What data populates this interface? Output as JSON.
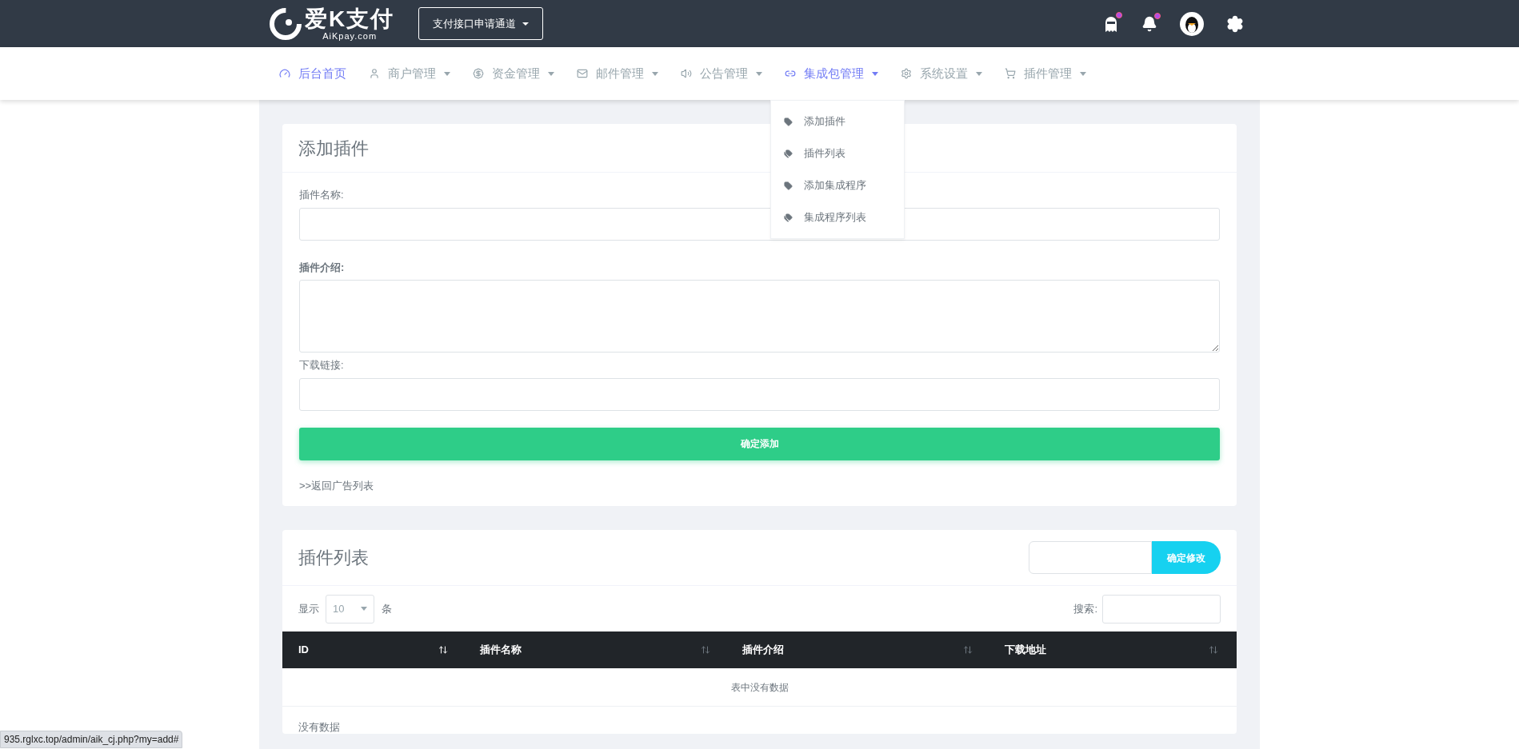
{
  "header": {
    "logo_text": "爱K支付",
    "logo_subtext": "AiKpay.com",
    "channel_button": "支付接口申请通道"
  },
  "nav": [
    {
      "label": "后台首页",
      "highlighted": true,
      "has_caret": false
    },
    {
      "label": "商户管理",
      "highlighted": false,
      "has_caret": true
    },
    {
      "label": "资金管理",
      "highlighted": false,
      "has_caret": true
    },
    {
      "label": "邮件管理",
      "highlighted": false,
      "has_caret": true
    },
    {
      "label": "公告管理",
      "highlighted": false,
      "has_caret": true
    },
    {
      "label": "集成包管理",
      "highlighted": true,
      "has_caret": true
    },
    {
      "label": "系统设置",
      "highlighted": false,
      "has_caret": true
    },
    {
      "label": "插件管理",
      "highlighted": false,
      "has_caret": true
    }
  ],
  "dropdown": [
    {
      "label": "添加插件",
      "kind": "add"
    },
    {
      "label": "插件列表",
      "kind": "list"
    },
    {
      "label": "添加集成程序",
      "kind": "add"
    },
    {
      "label": "集成程序列表",
      "kind": "list"
    }
  ],
  "add_form": {
    "title": "添加插件",
    "fields": [
      {
        "label": "插件名称:",
        "kind": "input",
        "bold": false
      },
      {
        "label": "插件介绍:",
        "kind": "textarea",
        "bold": true
      },
      {
        "label": "下载链接:",
        "kind": "input",
        "bold": false
      }
    ],
    "submit": "确定添加",
    "back_link": ">>返回广告列表"
  },
  "list": {
    "title": "插件列表",
    "modify_button": "确定修改",
    "show_label": "显示",
    "page_size": "10",
    "unit": "条",
    "search_label": "搜索:",
    "columns": [
      "ID",
      "插件名称",
      "插件介绍",
      "下载地址"
    ],
    "empty_message": "表中没有数据",
    "info": "没有数据"
  },
  "status_url": "935.rglxc.top/admin/aik_cj.php?my=add#"
}
